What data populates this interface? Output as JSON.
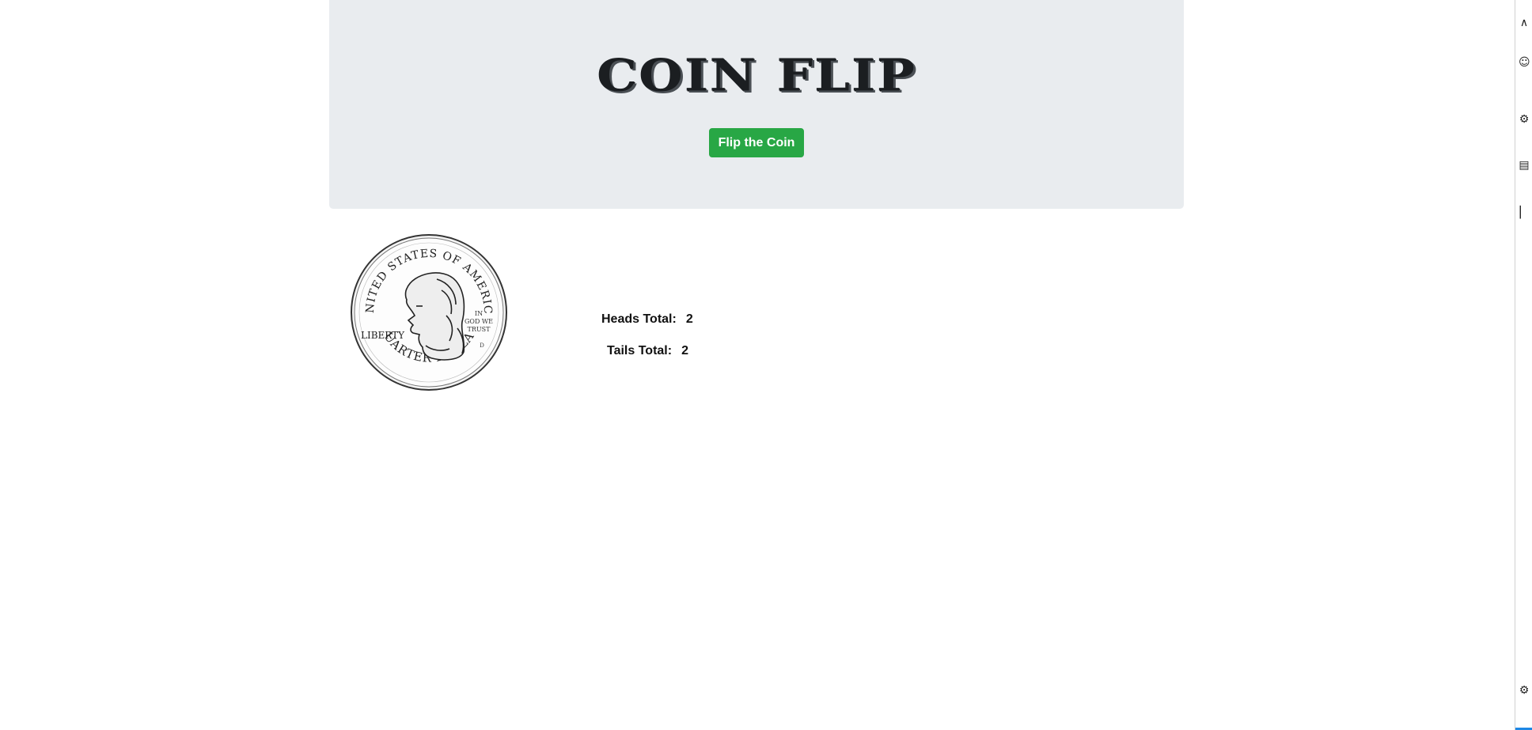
{
  "header": {
    "title": "COIN FLIP",
    "flip_button_label": "Flip the Coin"
  },
  "coin": {
    "face": "heads",
    "legend_top": "UNITED STATES OF AMERICA",
    "legend_left": "LIBERTY",
    "motto": [
      "IN",
      "GOD WE",
      "TRUST"
    ],
    "mint_mark": "D",
    "legend_bottom": "QUARTER DOLLAR"
  },
  "stats": {
    "heads_label": "Heads Total:",
    "heads_value": "2",
    "tails_label": "Tails Total:",
    "tails_value": "2"
  },
  "colors": {
    "jumbotron_bg": "#e9ecef",
    "button_green": "#28a745",
    "title_ink": "#1b1e21"
  },
  "side_strip": {
    "icons": [
      "chevron-up-icon",
      "person-icon",
      "gear-icon",
      "grid-icon",
      "panel-icon",
      "settings-icon"
    ]
  }
}
